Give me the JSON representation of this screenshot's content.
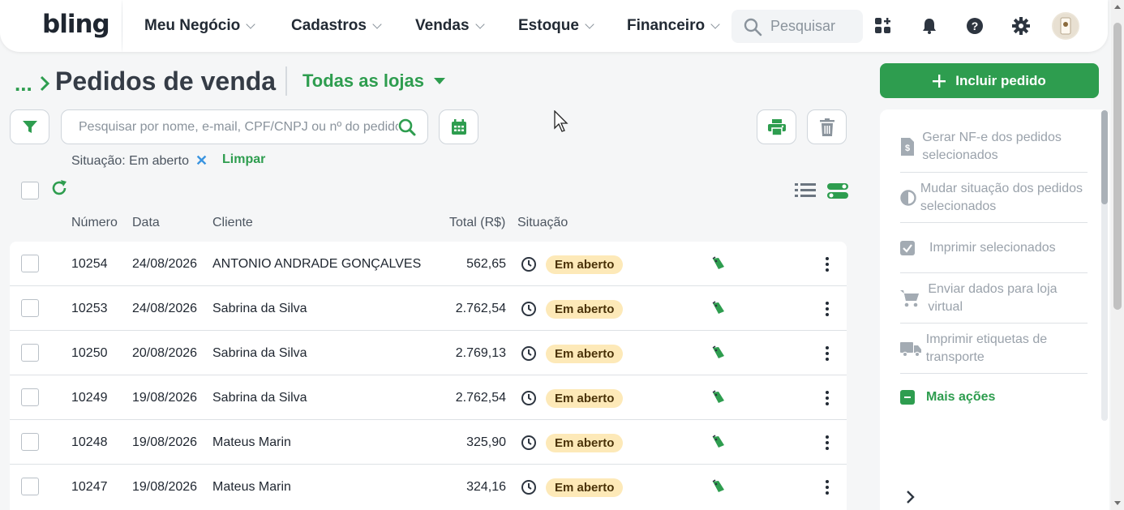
{
  "brand": {
    "logo": "bling",
    "accent": "#2e9d4f",
    "badge_bg": "#fde9b8"
  },
  "nav": {
    "items": [
      {
        "label": "Meu Negócio"
      },
      {
        "label": "Cadastros"
      },
      {
        "label": "Vendas"
      },
      {
        "label": "Estoque"
      },
      {
        "label": "Financeiro"
      }
    ],
    "search_label": "Pesquisar",
    "icons": [
      "apps-add-icon",
      "bell-icon",
      "help-icon",
      "gear-icon"
    ]
  },
  "breadcrumb": {
    "ellipsis": "...",
    "title": "Pedidos de venda"
  },
  "store_select": {
    "value": "Todas as lojas"
  },
  "include_button": {
    "label": "Incluir pedido"
  },
  "search": {
    "placeholder": "Pesquisar por nome, e-mail, CPF/CNPJ ou nº do pedido",
    "value": ""
  },
  "filters": {
    "chip": "Situação: Em aberto",
    "clear_label": "Limpar"
  },
  "table": {
    "headers": {
      "number": "Número",
      "date": "Data",
      "client": "Cliente",
      "total": "Total (R$)",
      "status": "Situação"
    },
    "rows": [
      {
        "number": "10254",
        "date": "24/08/2026",
        "client": "ANTONIO ANDRADE GONÇALVES",
        "total": "562,65",
        "status": "Em aberto"
      },
      {
        "number": "10253",
        "date": "24/08/2026",
        "client": "Sabrina da Silva",
        "total": "2.762,54",
        "status": "Em aberto"
      },
      {
        "number": "10250",
        "date": "20/08/2026",
        "client": "Sabrina da Silva",
        "total": "2.769,13",
        "status": "Em aberto"
      },
      {
        "number": "10249",
        "date": "19/08/2026",
        "client": "Sabrina da Silva",
        "total": "2.762,54",
        "status": "Em aberto"
      },
      {
        "number": "10248",
        "date": "19/08/2026",
        "client": "Mateus Marin",
        "total": "325,90",
        "status": "Em aberto"
      },
      {
        "number": "10247",
        "date": "19/08/2026",
        "client": "Mateus Marin",
        "total": "324,16",
        "status": "Em aberto"
      }
    ]
  },
  "side_panel": {
    "actions": [
      {
        "label": "Gerar NF-e dos pedidos selecionados",
        "icon": "invoice-icon"
      },
      {
        "label": "Mudar situação dos pedidos selecionados",
        "icon": "half-circle-icon"
      },
      {
        "label": "Imprimir selecionados",
        "icon": "checkbox-icon"
      },
      {
        "label": "Enviar dados para loja virtual",
        "icon": "cart-icon"
      },
      {
        "label": "Imprimir etiquetas de transporte",
        "icon": "truck-icon"
      }
    ],
    "more_label": "Mais ações"
  }
}
